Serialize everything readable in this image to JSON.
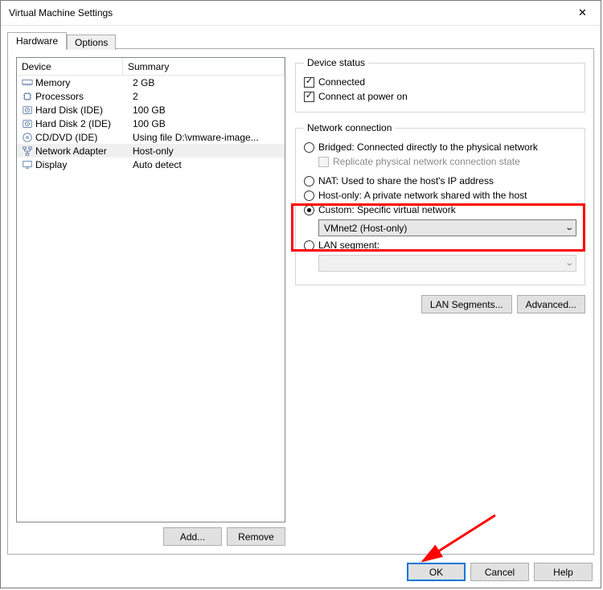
{
  "window": {
    "title": "Virtual Machine Settings"
  },
  "tabs": {
    "hardware": "Hardware",
    "options": "Options"
  },
  "device_list": {
    "header_device": "Device",
    "header_summary": "Summary",
    "rows": [
      {
        "name": "Memory",
        "summary": "2 GB"
      },
      {
        "name": "Processors",
        "summary": "2"
      },
      {
        "name": "Hard Disk (IDE)",
        "summary": "100 GB"
      },
      {
        "name": "Hard Disk 2 (IDE)",
        "summary": "100 GB"
      },
      {
        "name": "CD/DVD (IDE)",
        "summary": "Using file D:\\vmware-image..."
      },
      {
        "name": "Network Adapter",
        "summary": "Host-only"
      },
      {
        "name": "Display",
        "summary": "Auto detect"
      }
    ]
  },
  "left_buttons": {
    "add": "Add...",
    "remove": "Remove"
  },
  "device_status": {
    "legend": "Device status",
    "connected": "Connected",
    "connect_power_on": "Connect at power on"
  },
  "network_connection": {
    "legend": "Network connection",
    "bridged": "Bridged: Connected directly to the physical network",
    "replicate": "Replicate physical network connection state",
    "nat": "NAT: Used to share the host's IP address",
    "host_only": "Host-only: A private network shared with the host",
    "custom": "Custom: Specific virtual network",
    "custom_value": "VMnet2 (Host-only)",
    "lan_segment": "LAN segment:",
    "lan_value": ""
  },
  "right_buttons": {
    "lan_segments": "LAN Segments...",
    "advanced": "Advanced..."
  },
  "footer": {
    "ok": "OK",
    "cancel": "Cancel",
    "help": "Help"
  }
}
